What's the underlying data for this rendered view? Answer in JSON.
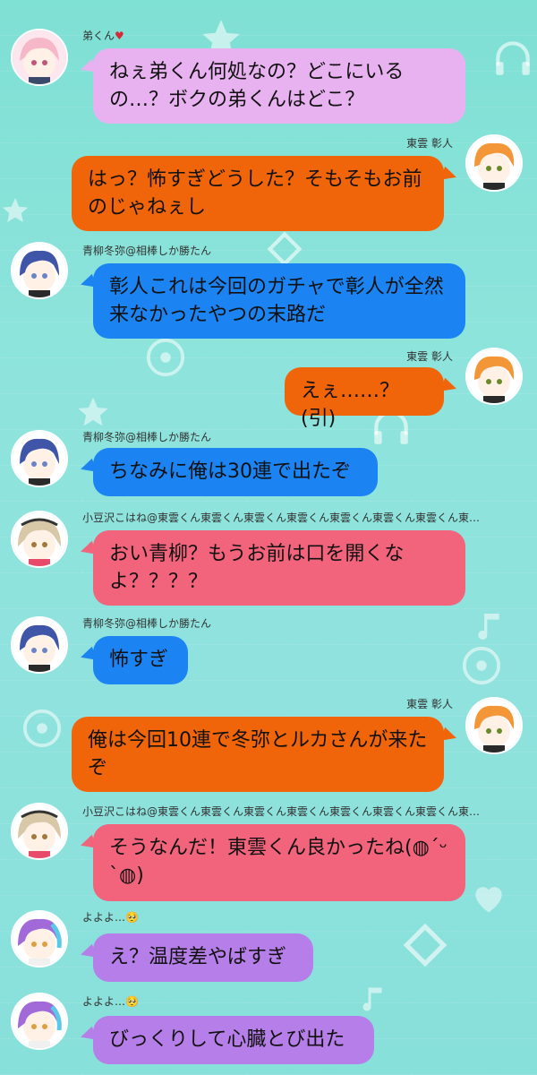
{
  "chat": {
    "messages": [
      {
        "sender": "弟くん",
        "sender_suffix": "♥",
        "side": "left",
        "bubble_color": "#e8b2f0",
        "avatar": "pink-hair-avatar",
        "text": "ねぇ弟くん何処なの？どこにいるの…？ボクの弟くんはどこ？"
      },
      {
        "sender": "東雲 彰人",
        "side": "right",
        "bubble_color": "#f0650a",
        "avatar": "orange-hair-avatar",
        "text": "はっ？怖すぎどうした？そもそもお前のじゃねぇし"
      },
      {
        "sender": "青柳冬弥@相棒しか勝たん",
        "side": "left",
        "bubble_color": "#1b84f2",
        "avatar": "blue-hair-avatar",
        "text": "彰人これは今回のガチャで彰人が全然来なかったやつの末路だ"
      },
      {
        "sender": "東雲 彰人",
        "side": "right",
        "bubble_color": "#f0650a",
        "avatar": "orange-hair-avatar",
        "text": "えぇ……？(引)"
      },
      {
        "sender": "青柳冬弥@相棒しか勝たん",
        "side": "left",
        "bubble_color": "#1b84f2",
        "avatar": "blue-hair-avatar",
        "text": "ちなみに俺は30連で出たぞ"
      },
      {
        "sender": "小豆沢こはね@東雲くん東雲くん東雲くん東雲くん東雲くん東雲くん東雲くん東…",
        "side": "left",
        "bubble_color": "#f2637c",
        "avatar": "beige-hair-avatar",
        "text": "おい青柳？もうお前は口を開くなよ？？？？"
      },
      {
        "sender": "青柳冬弥@相棒しか勝たん",
        "side": "left",
        "bubble_color": "#1b84f2",
        "avatar": "blue-hair-avatar",
        "text": "怖すぎ"
      },
      {
        "sender": "東雲 彰人",
        "side": "right",
        "bubble_color": "#f0650a",
        "avatar": "orange-hair-avatar",
        "text": "俺は今回10連で冬弥とルカさんが来たぞ"
      },
      {
        "sender": "小豆沢こはね@東雲くん東雲くん東雲くん東雲くん東雲くん東雲くん東雲くん東…",
        "side": "left",
        "bubble_color": "#f2637c",
        "avatar": "beige-hair-avatar",
        "text": "そうなんだ！東雲くん良かったね(◍ˊᵕˋ◍)"
      },
      {
        "sender": "よよよ…",
        "sender_suffix": "🥺",
        "side": "left",
        "bubble_color": "#b67ee8",
        "avatar": "purple-hair-avatar",
        "text": "え？温度差やばすぎ"
      },
      {
        "sender": "よよよ…",
        "sender_suffix": "🥺",
        "side": "left",
        "bubble_color": "#b67ee8",
        "avatar": "purple-hair-avatar",
        "text": "びっくりして心臓とび出た"
      }
    ]
  },
  "colors": {
    "background": "#8ae2da",
    "pink_bubble": "#e8b2f0",
    "orange_bubble": "#f0650a",
    "blue_bubble": "#1b84f2",
    "red_bubble": "#f2637c",
    "purple_bubble": "#b67ee8"
  },
  "background_icons": [
    "star-icon",
    "headphones-icon",
    "music-note-icon",
    "disc-icon",
    "diamond-icon",
    "heart-icon"
  ]
}
